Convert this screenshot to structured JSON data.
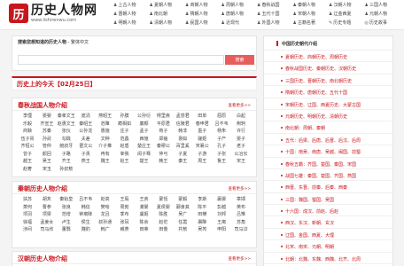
{
  "logo": {
    "badge": "历",
    "title": "历史人物网",
    "url": "www.lishirenwu.com"
  },
  "topnav": [
    {
      "icon": "♟",
      "label": "上古人物"
    },
    {
      "icon": "♟",
      "label": "夏朝人物"
    },
    {
      "icon": "♟",
      "label": "商朝人物"
    },
    {
      "icon": "♟",
      "label": "周朝人物"
    },
    {
      "icon": "♟",
      "label": "春秋战国"
    },
    {
      "icon": "♟",
      "label": "秦朝人物"
    },
    {
      "icon": "♟",
      "label": "汉朝人物"
    },
    {
      "icon": "♟",
      "label": "三国人物"
    },
    {
      "icon": "♟",
      "label": "晋朝人物"
    },
    {
      "icon": "♟",
      "label": "南北朝"
    },
    {
      "icon": "♟",
      "label": "隋朝人物"
    },
    {
      "icon": "♟",
      "label": "唐朝人物"
    },
    {
      "icon": "♟",
      "label": "五代十国"
    },
    {
      "icon": "♟",
      "label": "宋朝人物"
    },
    {
      "icon": "♟",
      "label": "辽金西夏"
    },
    {
      "icon": "♟",
      "label": "元朝人物"
    },
    {
      "icon": "♟",
      "label": "明朝人物"
    },
    {
      "icon": "♟",
      "label": "清朝人物"
    },
    {
      "icon": "♟",
      "label": "民国人物"
    },
    {
      "icon": "♟",
      "label": "近现代"
    },
    {
      "icon": "♟",
      "label": "外国人物"
    },
    {
      "icon": "♟",
      "label": "古籍名著"
    },
    {
      "icon": "✎",
      "label": "历史专题"
    },
    {
      "icon": "◎",
      "label": "历史故事"
    }
  ],
  "search": {
    "title_bold": "搜索您想知道的历史人物",
    "title_rest": " - 繁体中文",
    "placeholder": "",
    "button": "搜索"
  },
  "today": "历史上的今天【02月25日】",
  "panels": [
    {
      "title": "春秋战国人物介绍",
      "more": "查看更多>>",
      "names": [
        "李悝",
        "晏婴",
        "秦孝文王",
        "庞涓",
        "燕昭王",
        "孙膑",
        "公孙衍",
        "樗里疾",
        "孟尝君",
        "田单",
        "屈原",
        "白起",
        "乐毅",
        "齐宣王",
        "赵惠文王",
        "秦昭王",
        "范雎",
        "蔺相如",
        "廉颇",
        "平原君",
        "信陵君",
        "春申君",
        "吕不韦",
        "荆轲",
        "商鞅",
        "苏秦",
        "张仪",
        "公孙龙",
        "惠施",
        "庄子",
        "孟子",
        "荀子",
        "韩非",
        "墨子",
        "杨朱",
        "许行",
        "伍子胥",
        "孙武",
        "勾践",
        "夫差",
        "文种",
        "范蠡",
        "西施",
        "郑袖",
        "褒姒",
        "骊姬",
        "子产",
        "晏子",
        "齐桓公",
        "管仲",
        "鲍叔牙",
        "晋文公",
        "介子推",
        "赵盾",
        "楚庄王",
        "秦穆公",
        "百里奚",
        "宋襄公",
        "孔子",
        "老子",
        "曾子",
        "颜回",
        "子路",
        "子贡",
        "冉有",
        "宰我",
        "闵子骞",
        "仲弓",
        "子夏",
        "子游",
        "子张",
        "公冶长",
        "越王",
        "吴王",
        "齐王",
        "燕王",
        "魏王",
        "赵王",
        "楚王",
        "韩王",
        "秦王",
        "周王",
        "鲁王",
        "宋王",
        "赵奢",
        "宋玉",
        "孙叔敖"
      ]
    },
    {
      "title": "秦朝历史人物介绍",
      "more": "查看更多>>",
      "names": [
        "扶苏",
        "胡亥",
        "秦始皇",
        "吕不韦",
        "赵高",
        "王翦",
        "王贲",
        "蒙恬",
        "蒙毅",
        "李斯",
        "嬴婴",
        "章邯",
        "萧何",
        "曹参",
        "张良",
        "韩信",
        "樊哙",
        "周勃",
        "灌婴",
        "夏侯婴",
        "郦食其",
        "陈平",
        "彭越",
        "英布",
        "项羽",
        "项梁",
        "范增",
        "钟离昧",
        "龙且",
        "季布",
        "虞姬",
        "陈胜",
        "吴广",
        "田横",
        "刘邦",
        "吕雉",
        "徐福",
        "孟姜女",
        "卢生",
        "侯生",
        "叔孙通",
        "张耳",
        "陈余",
        "赵佗",
        "任嚣",
        "屠睢",
        "王离",
        "苏角",
        "涉间",
        "司马欣",
        "董翳",
        "魏豹",
        "韩广",
        "臧荼",
        "田荣",
        "田儋",
        "共敖",
        "吴芮",
        "申阳",
        "司马卬"
      ]
    },
    {
      "title": "汉朝历史人物介绍",
      "more": "查看更多>>",
      "names": []
    }
  ],
  "sidebar": {
    "title": "中国历史朝代介绍",
    "items": [
      {
        "pre": "",
        "label": "夏朝历史、商朝历史、周朝历史"
      },
      {
        "pre": "",
        "label": "春秋战国历史、秦朝历史、汉朝历史"
      },
      {
        "pre": "",
        "label": "三国历史、晋朝历史、南北朝历史"
      },
      {
        "pre": "",
        "label": "隋朝历史、唐朝历史、五代十国"
      },
      {
        "pre": "",
        "label": "宋朝历史、辽国、西夏历史、大蒙古国"
      },
      {
        "pre": "",
        "label": "元朝历史、明朝历史、清朝历史"
      },
      {
        "pre": "",
        "label": "南北朝：周朝、秦朝"
      },
      {
        "pre": "",
        "label": "五代：后梁、后唐、后晋、后汉、后周"
      },
      {
        "pre": "",
        "label": "十国：南吴、南唐、吴越、闽国、前蜀"
      },
      {
        "pre": "",
        "label": "春秋五霸：齐国、楚国、秦国、宋国"
      },
      {
        "pre": "",
        "label": "战国七雄：秦国、楚国、齐国、燕国"
      },
      {
        "pre": "",
        "label": "西晋、东晋、前秦、后秦、西秦"
      },
      {
        "pre": "",
        "label": "三国：魏国、蜀国、吴国"
      },
      {
        "pre": "",
        "label": "十六国：成汉、前赵、后赵"
      },
      {
        "pre": "",
        "label": "西汉、东汉、新朝、玄汉"
      },
      {
        "pre": "",
        "label": "辽国、金国、西夏、大理"
      },
      {
        "pre": "",
        "label": "北宋、南宋、元朝、明朝"
      },
      {
        "pre": "",
        "label": "北朝：北魏、东魏、西魏、北齐、北周"
      }
    ]
  }
}
